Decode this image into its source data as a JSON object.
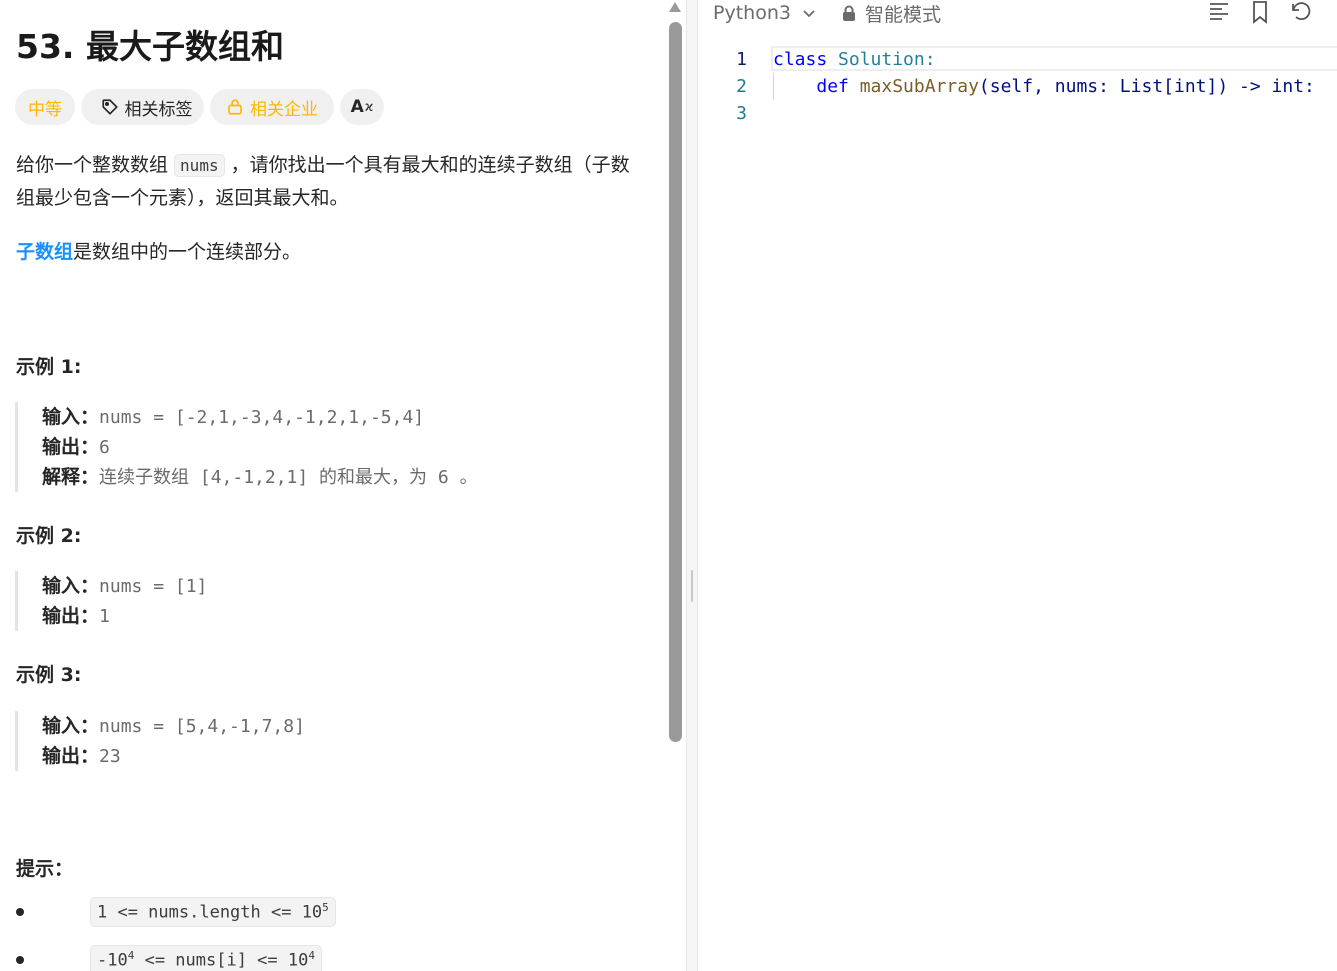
{
  "problem": {
    "title": "53. 最大子数组和",
    "tags": {
      "difficulty": "中等",
      "topics": "相关标签",
      "companies": "相关企业",
      "translate": "A"
    },
    "description_part1": "给你一个整数数组 ",
    "description_code": "nums",
    "description_part2": " ，请你找出一个具有最大和的连续子数组（子数组最少包含一个元素），返回其最大和。",
    "subarray_link": "子数组",
    "subarray_text": "是数组中的一个连续部分。",
    "examples": [
      {
        "title": "示例 1:",
        "input_label": "输入：",
        "input": "nums = [-2,1,-3,4,-1,2,1,-5,4]",
        "output_label": "输出：",
        "output": "6",
        "explanation_label": "解释：",
        "explanation": "连续子数组 [4,-1,2,1] 的和最大，为 6 。"
      },
      {
        "title": "示例 2:",
        "input_label": "输入：",
        "input": "nums = [1]",
        "output_label": "输出：",
        "output": "1"
      },
      {
        "title": "示例 3:",
        "input_label": "输入：",
        "input": "nums = [5,4,-1,7,8]",
        "output_label": "输出：",
        "output": "23"
      }
    ],
    "hints_title": "提示：",
    "hints": [
      {
        "base": "1 <= nums.length <= 10",
        "exp": "5"
      },
      {
        "base": "-10",
        "exp": "4",
        "rest": " <= nums[i] <= 10",
        "exp2": "4"
      }
    ]
  },
  "editor": {
    "language": "Python3",
    "mode": "智能模式",
    "lines": [
      {
        "number": "1",
        "kw": "class",
        "rest": " Solution:"
      },
      {
        "number": "2",
        "indent": "    ",
        "kw": "def",
        "fn": " maxSubArray",
        "sig": "(self, nums: List[int]) -> int:"
      },
      {
        "number": "3"
      }
    ]
  },
  "colors": {
    "accent": "#1a90ff",
    "difficulty_medium": "#ffb700",
    "keyword": "#0000ff",
    "line_number": "#237893"
  }
}
